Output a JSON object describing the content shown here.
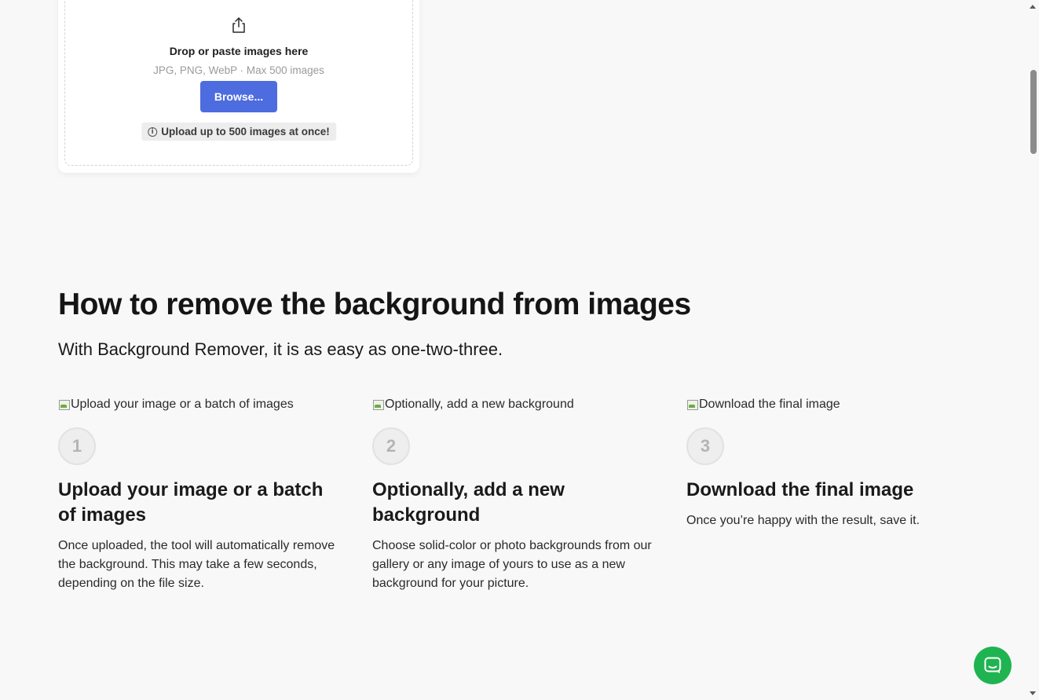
{
  "upload": {
    "icon": "share-upload-icon",
    "title": "Drop or paste images here",
    "subtitle": "JPG, PNG, WebP · Max 500 images",
    "browse_label": "Browse...",
    "notice": "Upload up to 500 images at once!",
    "notice_icon": "info-icon"
  },
  "howto": {
    "title": "How to remove the background from images",
    "subtitle": "With Background Remover, it is as easy as one-two-three.",
    "steps": [
      {
        "image_alt": "Upload your image or a batch of images",
        "number": "1",
        "title": "Upload your image or a batch of images",
        "description": "Once uploaded, the tool will automatically remove the background. This may take a few seconds, depending on the file size."
      },
      {
        "image_alt": "Optionally, add a new background",
        "number": "2",
        "title": "Optionally, add a new background",
        "description": "Choose solid-color or photo backgrounds from our gallery or any image of yours to use as a new background for your picture."
      },
      {
        "image_alt": "Download the final image",
        "number": "3",
        "title": "Download the final image",
        "description": "Once you’re happy with the result, save it."
      }
    ]
  },
  "chat": {
    "icon": "chat-icon"
  },
  "colors": {
    "accent": "#4d6ce0",
    "chat": "#1fb451",
    "background": "#f8f8f8"
  }
}
